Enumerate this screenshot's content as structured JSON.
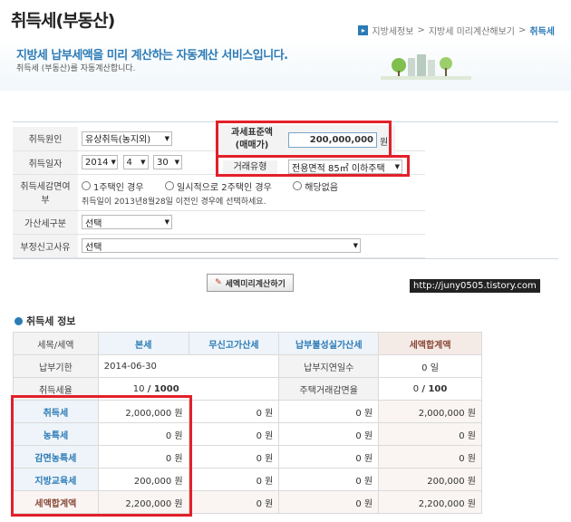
{
  "header": {
    "title": "취득세(부동산)",
    "breadcrumb": [
      "지방세정보",
      "지방세 미리계산해보기",
      "취득세"
    ]
  },
  "banner": {
    "title": "지방세 납부세액을 미리 계산하는 자동계산 서비스입니다.",
    "subtitle": "취득세 (부동산)를 자동계산합니다."
  },
  "form": {
    "acquisition_cause_label": "취득원인",
    "acquisition_cause_value": "유상취득(농지외)",
    "tax_base_label_1": "과세표준액",
    "tax_base_label_2": "(매매가)",
    "tax_base_value": "200,000,000",
    "tax_base_unit": "원",
    "acquisition_date_label": "취득일자",
    "year": "2014",
    "month": "4",
    "day": "30",
    "transaction_type_label": "거래유형",
    "transaction_type_value": "전용면적 85㎡ 이하주택",
    "reduction_label": "취득세감면여부",
    "reduction_options": [
      "1주택인 경우",
      "일시적으로 2주택인 경우",
      "해당없음"
    ],
    "reduction_note": "취득일이 2013년8월28일 이전인 경우에 선택하세요.",
    "penalty_label": "가산세구분",
    "penalty_value": "선택",
    "improper_label": "부정신고사유",
    "improper_value": "선택"
  },
  "calc_button_label": "세액미리계산하기",
  "watermark": "http://juny0505.tistory.com",
  "section_title": "취득세 정보",
  "tax_table": {
    "headers": [
      "세목/세액",
      "본세",
      "무신고가산세",
      "납부불성실가산세",
      "세액합계액"
    ],
    "due_date_label": "납부기한",
    "due_date_value": "2014-06-30",
    "overdue_label": "납부지연일수",
    "overdue_value": "0",
    "overdue_unit": "일",
    "rate_label": "취득세율",
    "rate_num": "10",
    "rate_den": "/ 1000",
    "housing_label": "주택거래감면율",
    "housing_num": "0",
    "housing_den": "/ 100",
    "rows": [
      {
        "label": "취득세",
        "base": "2,000,000 원",
        "nofile": "0 원",
        "late": "0 원",
        "total": "2,000,000 원"
      },
      {
        "label": "농특세",
        "base": "0 원",
        "nofile": "0 원",
        "late": "0 원",
        "total": "0 원"
      },
      {
        "label": "감면농특세",
        "base": "0 원",
        "nofile": "0 원",
        "late": "0 원",
        "total": "0 원"
      },
      {
        "label": "지방교육세",
        "base": "200,000 원",
        "nofile": "0 원",
        "late": "0 원",
        "total": "200,000 원"
      },
      {
        "label": "세액합계액",
        "base": "2,200,000 원",
        "nofile": "0 원",
        "late": "0 원",
        "total": "2,200,000 원"
      }
    ]
  },
  "colors": {
    "accent": "#2c7bb6",
    "highlight": "#e3202a"
  }
}
